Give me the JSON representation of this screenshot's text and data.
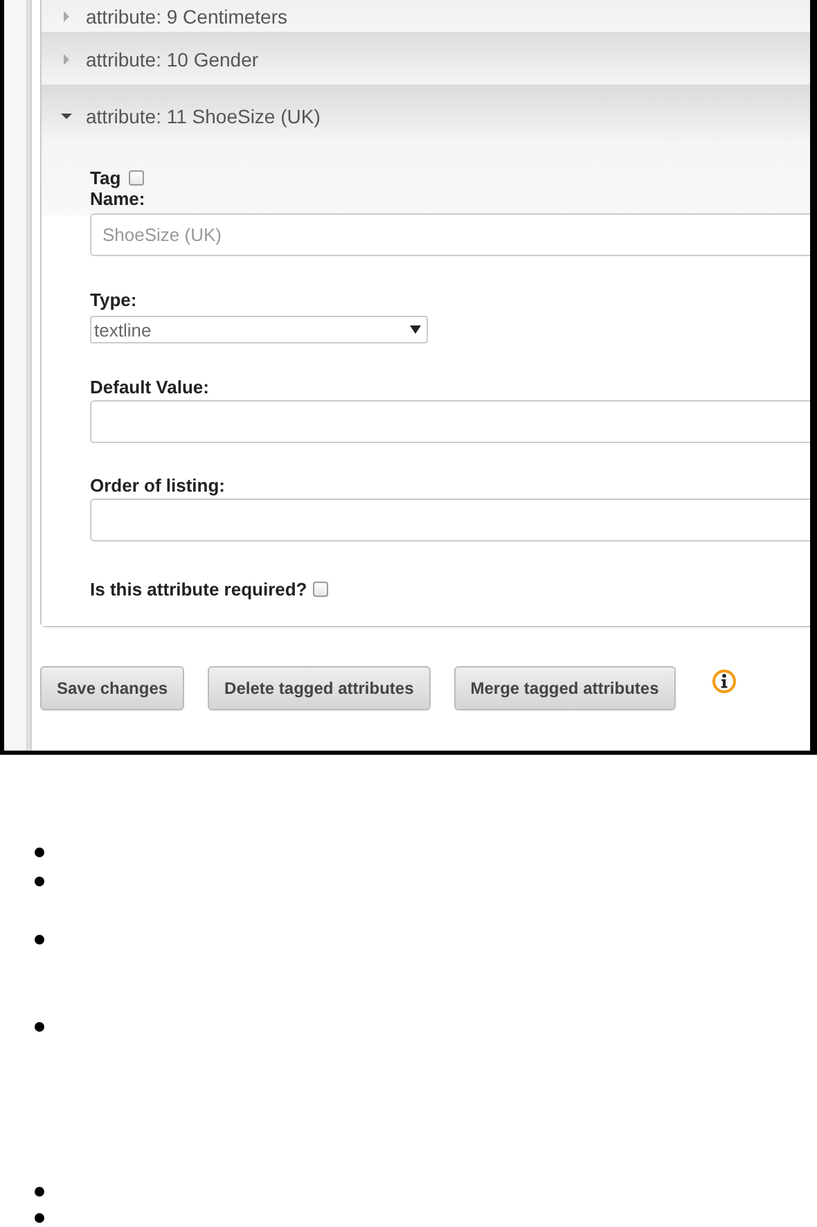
{
  "accordion": [
    {
      "title": "attribute: 9 Centimeters",
      "expanded": false
    },
    {
      "title": "attribute: 10 Gender",
      "expanded": false
    },
    {
      "title": "attribute: 11 ShoeSize (UK)",
      "expanded": true,
      "form": {
        "tag_label": "Tag",
        "tag_checked": false,
        "name_label": "Name:",
        "name_placeholder": "ShoeSize (UK)",
        "type_label": "Type:",
        "type_value": "textline",
        "default_label": "Default Value:",
        "order_label": "Order of listing:",
        "required_label": "Is this attribute required?",
        "required_checked": false
      }
    }
  ],
  "buttons": [
    "Save changes",
    "Delete tagged attributes",
    "Merge tagged attributes"
  ],
  "bullets": [
    {
      "kind": "bullet"
    },
    {
      "kind": "bullet"
    },
    {
      "kind": "bullet"
    },
    {
      "kind": "bullet"
    },
    {
      "kind": "bullet"
    },
    {
      "kind": "bullet"
    }
  ]
}
